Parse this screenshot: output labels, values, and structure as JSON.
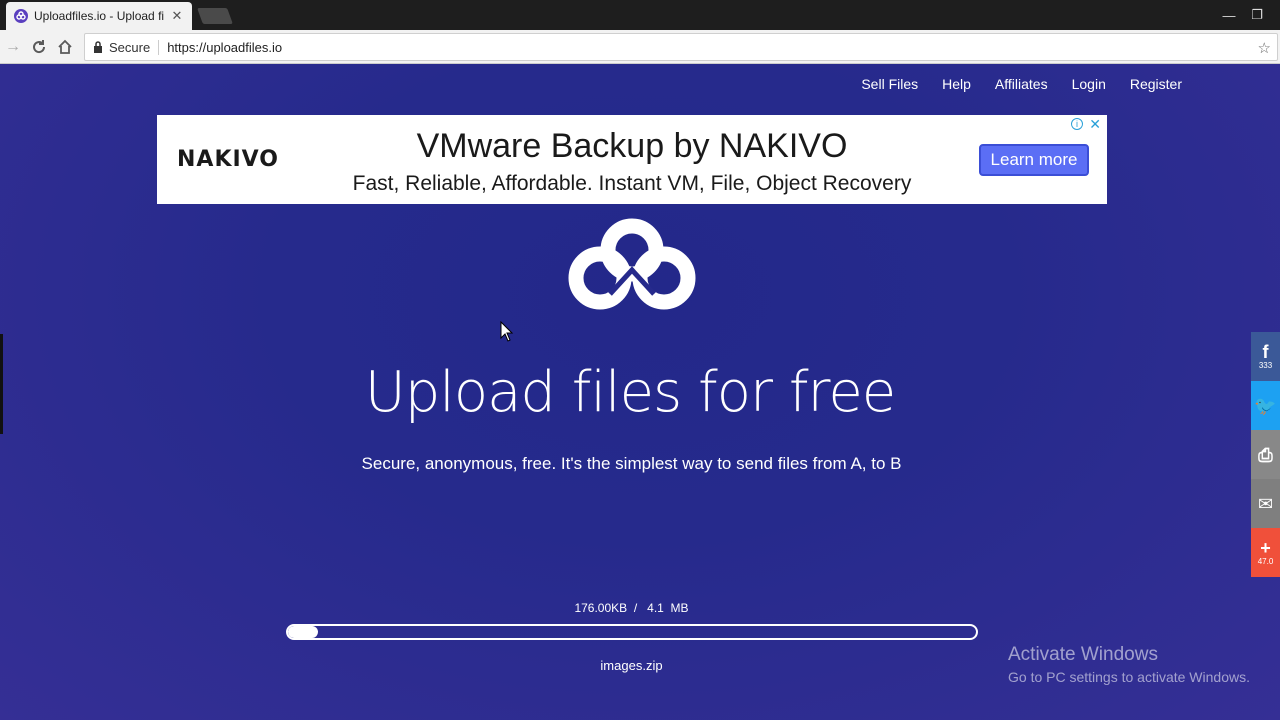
{
  "browser": {
    "tab_title": "Uploadfiles.io - Upload fi",
    "tab_close": "✕",
    "secure_label": "Secure",
    "url": "https://uploadfiles.io",
    "star": "☆",
    "minimize": "—",
    "restore": "❐"
  },
  "nav": {
    "items": [
      "Sell Files",
      "Help",
      "Affiliates",
      "Login",
      "Register"
    ]
  },
  "ad": {
    "brand": "NAKIVO",
    "headline": "VMware Backup by NAKIVO",
    "subline": "Fast, Reliable, Affordable. Instant VM, File, Object Recovery",
    "cta": "Learn more",
    "info": "i",
    "close": "✕"
  },
  "hero": {
    "title": "Upload files for free",
    "subtitle": "Secure, anonymous, free. It's the simplest way to send files from A, to B"
  },
  "upload": {
    "progress_text": "176.00KB  /   4.1  MB",
    "progress_fraction": 0.043,
    "filename": "images.zip"
  },
  "watermark": {
    "line1": "Activate Windows",
    "line2": "Go to PC settings to activate Windows."
  },
  "share": [
    {
      "icon": "facebook-icon",
      "glyph": "f",
      "count": "333",
      "color": "#3b5998"
    },
    {
      "icon": "twitter-icon",
      "glyph": "🐦",
      "count": "",
      "color": "#1da1f2"
    },
    {
      "icon": "print-icon",
      "glyph": "⎙",
      "count": "",
      "color": "#888888"
    },
    {
      "icon": "email-icon",
      "glyph": "✉",
      "count": "",
      "color": "#7f7f7f"
    },
    {
      "icon": "more-icon",
      "glyph": "+",
      "count": "47.0",
      "color": "#f0503a"
    }
  ]
}
